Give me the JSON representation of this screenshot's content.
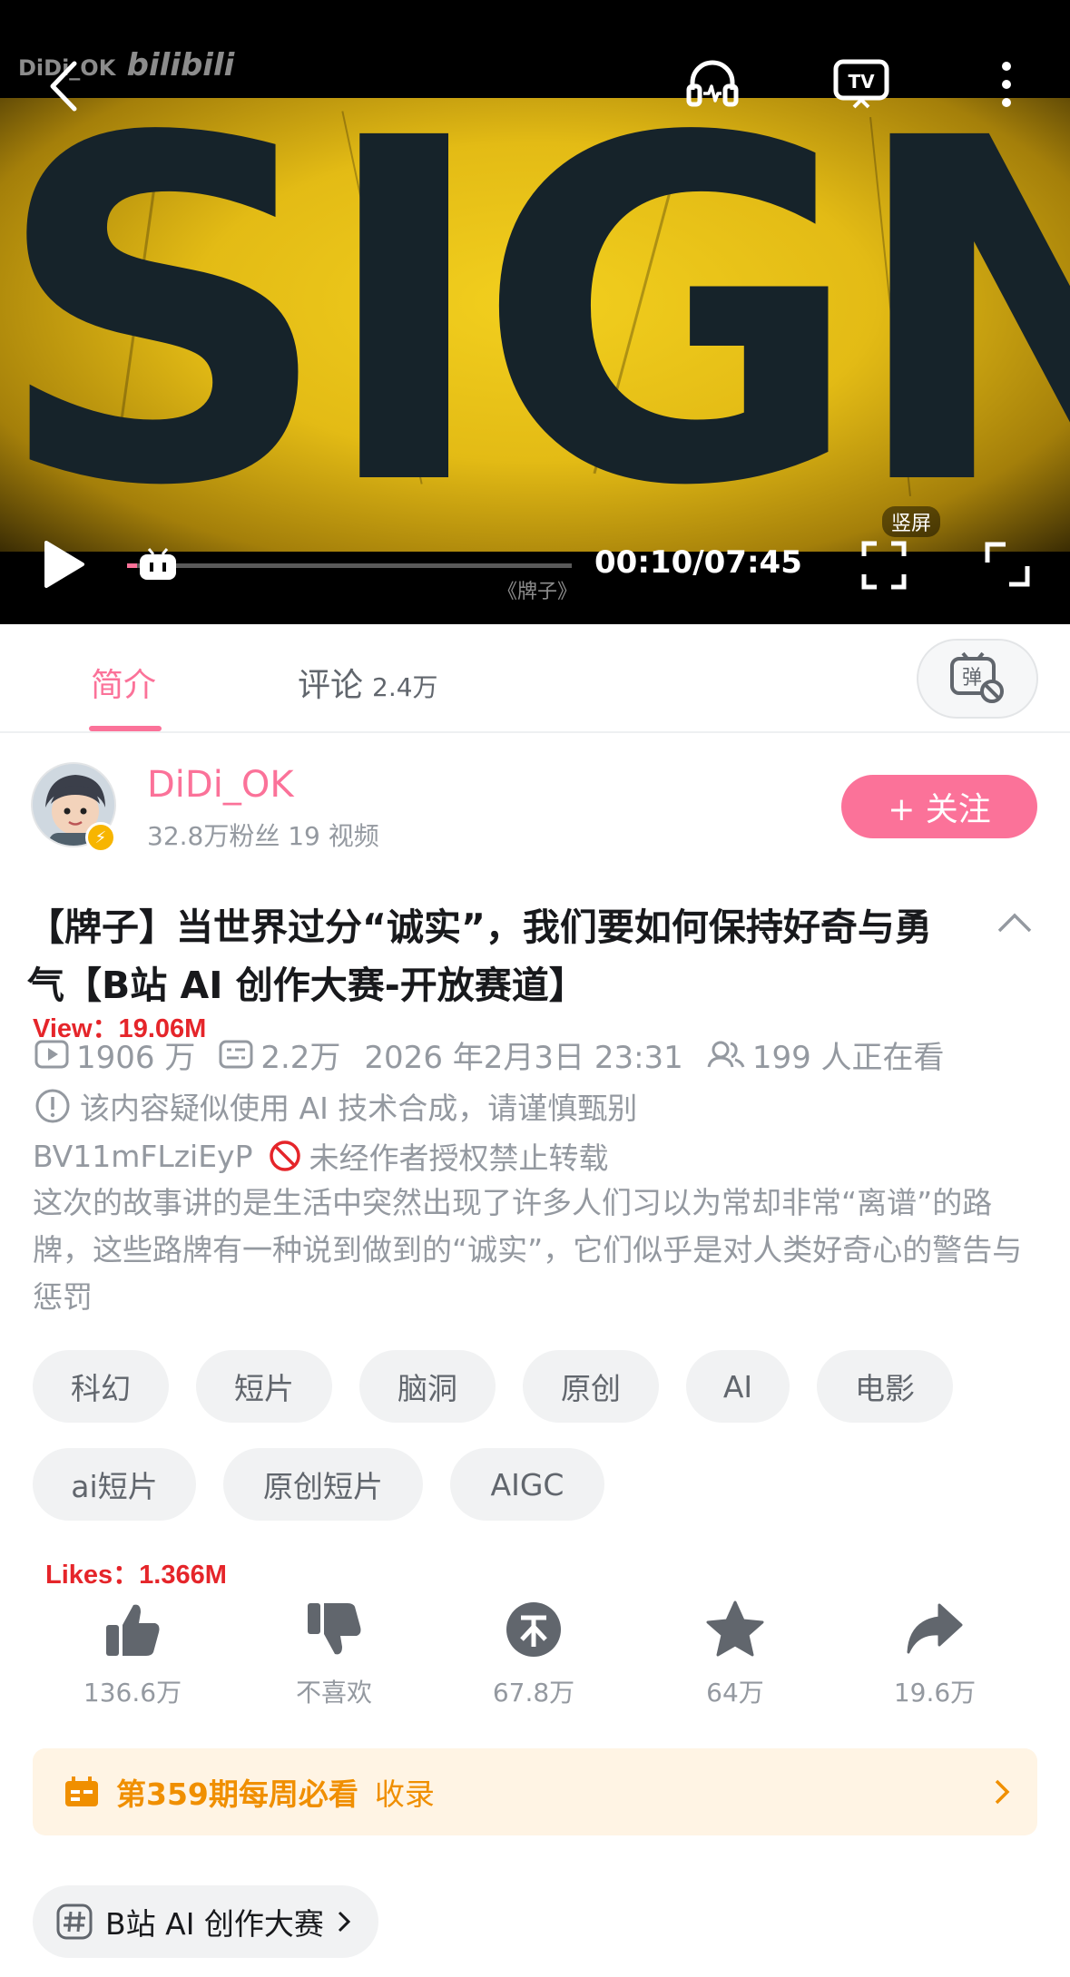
{
  "player": {
    "watermark_user": "DiDi_OK",
    "watermark_brand": "bilibili",
    "video_text": "SIGN",
    "progress_title": "《牌子》",
    "time": "00:10/07:45",
    "progress_fraction": 0.022,
    "vertical_badge": "竖屏",
    "accent_color": "#fb7299"
  },
  "tabs": {
    "intro": "简介",
    "comments": "评论",
    "comments_count": "2.4万",
    "danmaku_icon": "弹"
  },
  "uploader": {
    "name": "DiDi_OK",
    "stats": "32.8万粉丝  19 视频",
    "follow_label": "+ 关注"
  },
  "video": {
    "title": "【牌子】当世界过分“诚实”，我们要如何保持好奇与勇气【B站 AI 创作大赛-开放赛道】",
    "overlay_view": "View：19.06M",
    "plays": "1906 万",
    "danmaku": "2.2万",
    "date": "2026 年2月3日 23:31",
    "watching": "199 人正在看",
    "ai_notice": "该内容疑似使用 AI 技术合成，请谨慎甄别",
    "bvid": "BV11mFLziEyP",
    "repost_notice": "未经作者授权禁止转载",
    "description": "这次的故事讲的是生活中突然出现了许多人们习以为常却非常“离谱”的路牌，这些路牌有一种说到做到的“诚实”，它们似乎是对人类好奇心的警告与惩罚"
  },
  "tags": [
    "科幻",
    "短片",
    "脑洞",
    "原创",
    "AI",
    "电影",
    "ai短片",
    "原创短片",
    "AIGC"
  ],
  "overlay_likes": "Likes：1.366M",
  "actions": {
    "like": "136.6万",
    "dislike": "不喜欢",
    "coin": "67.8万",
    "favorite": "64万",
    "share": "19.6万"
  },
  "weekly": {
    "label": "第359期每周必看",
    "collect": "收录"
  },
  "event": {
    "label": "B站 AI 创作大赛"
  }
}
